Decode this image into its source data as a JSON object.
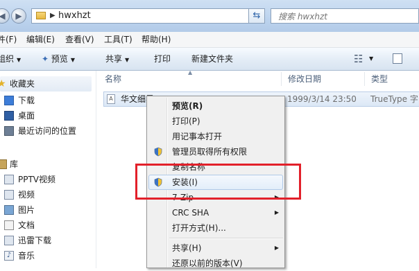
{
  "address": {
    "path": "hwxhzt",
    "search_placeholder": "搜索 hwxhzt"
  },
  "menubar": [
    "件(F)",
    "编辑(E)",
    "查看(V)",
    "工具(T)",
    "帮助(H)"
  ],
  "toolbar": {
    "organize": "组织",
    "preview": "预览",
    "share": "共享",
    "print": "打印",
    "new_folder": "新建文件夹"
  },
  "nav": {
    "favorites": "收藏夹",
    "download": "下载",
    "desktop": "桌面",
    "recent": "最近访问的位置",
    "libraries": "库",
    "pptv": "PPTV视频",
    "video": "视频",
    "pictures": "图片",
    "documents": "文档",
    "xunlei": "迅雷下载",
    "music": "音乐"
  },
  "columns": {
    "name": "名称",
    "date": "修改日期",
    "type": "类型"
  },
  "file": {
    "name": "华文细黑",
    "date": "1999/3/14 23:50",
    "type": "TrueType 字"
  },
  "context_menu": {
    "preview": "预览(R)",
    "print": "打印(P)",
    "notepad": "用记事本打开",
    "admin": "管理员取得所有权限",
    "copy_name": "复制名称",
    "install": "安装(I)",
    "zip": "7-Zip",
    "crc": "CRC SHA",
    "open_with": "打开方式(H)...",
    "share": "共享(H)",
    "restore": "还原以前的版本(V)"
  },
  "colors": {
    "annotation": "#e2202a",
    "chrome": "#bcd3ee"
  }
}
